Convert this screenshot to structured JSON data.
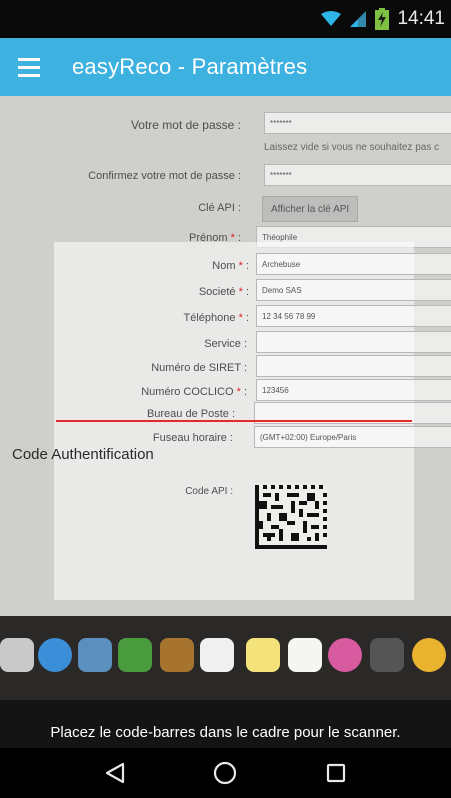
{
  "status_bar": {
    "time": "14:41",
    "icons": [
      "wifi-icon",
      "signal-icon",
      "battery-charging-icon"
    ]
  },
  "app_bar": {
    "title": "easyReco - Paramètres",
    "menu_icon": "hamburger-menu-icon"
  },
  "form": {
    "password_label": "Votre mot de passe :",
    "password_value": "*******",
    "password_hint": "Laissez vide si vous ne souhaitez pas c",
    "confirm_label": "Confirmez votre mot de passe :",
    "confirm_value": "*******",
    "api_key_label": "Clé API :",
    "api_key_button": "Afficher la clé API",
    "firstname_label": "Prénom",
    "firstname_value": "Théophile",
    "lastname_label": "Nom",
    "lastname_value": "Archebuse",
    "company_label": "Societé",
    "company_value": "Demo SAS",
    "phone_label": "Téléphone",
    "phone_value": "12 34 56 78 99",
    "service_label": "Service :",
    "service_value": "",
    "siret_label": "Numéro de SIRET :",
    "siret_value": "",
    "coclico_label": "Numéro COCLICO",
    "coclico_value": "123456",
    "post_label": "Bureau de Poste :",
    "post_value": "",
    "timezone_label": "Fuseau horaire :",
    "timezone_value": "(GMT+02:00) Europe/Paris",
    "required_mark": "*",
    "colon": ":"
  },
  "auth_section": {
    "title": "Code Authentification",
    "api_code_label": "Code API :"
  },
  "scanner": {
    "hint": "Placez le code-barres dans le cadre pour le scanner.",
    "line_color": "#e52a2a"
  },
  "dock_icons": [
    "finder-icon",
    "safari-icon",
    "preview-icon",
    "stickies-icon",
    "notes-icon",
    "calendar-icon",
    "stickynote-icon",
    "reminders-icon",
    "itunes-icon",
    "photobooth-icon",
    "chrome-icon"
  ],
  "nav_bar": {
    "back_icon": "back-triangle-icon",
    "home_icon": "home-circle-icon",
    "recents_icon": "recents-square-icon"
  }
}
